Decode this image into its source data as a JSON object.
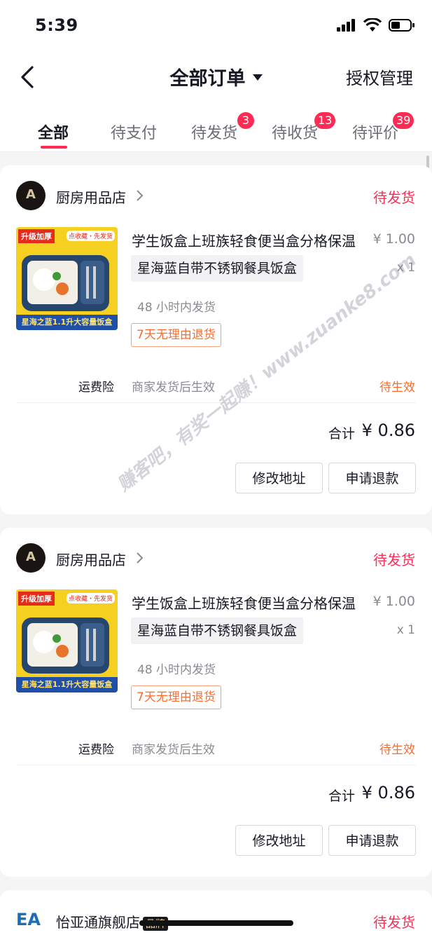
{
  "status_bar": {
    "time": "5:39"
  },
  "nav": {
    "title": "全部订单",
    "right": "授权管理"
  },
  "tabs": [
    {
      "label": "全部"
    },
    {
      "label": "待支付"
    },
    {
      "label": "待发货",
      "badge": "3"
    },
    {
      "label": "待收货",
      "badge": "13"
    },
    {
      "label": "待评价",
      "badge": "39"
    }
  ],
  "orders": [
    {
      "shop": "厨房用品店",
      "shop_logo_text": "A",
      "status": "待发货",
      "image_tags": {
        "top": "升级加厚",
        "fav": "点收藏・先发货",
        "bottom": "星海之蓝1.1升大容量饭盒"
      },
      "title": "学生饭盒上班族轻食便当盒分格保温",
      "price": "¥ 1.00",
      "sku": "星海蓝自带不锈钢餐具饭盒",
      "qty": "x 1",
      "ship_note": "48 小时内发货",
      "return_tag": "7天无理由退货",
      "insurance": {
        "label": "运费险",
        "desc": "商家发货后生效",
        "status": "待生效"
      },
      "total_label": "合计",
      "total": "¥ 0.86",
      "buttons": {
        "address": "修改地址",
        "refund": "申请退款"
      }
    },
    {
      "shop": "厨房用品店",
      "shop_logo_text": "A",
      "status": "待发货",
      "image_tags": {
        "top": "升级加厚",
        "fav": "点收藏・先发货",
        "bottom": "星海之蓝1.1升大容量饭盒"
      },
      "title": "学生饭盒上班族轻食便当盒分格保温",
      "price": "¥ 1.00",
      "sku": "星海蓝自带不锈钢餐具饭盒",
      "qty": "x 1",
      "ship_note": "48 小时内发货",
      "return_tag": "7天无理由退货",
      "insurance": {
        "label": "运费险",
        "desc": "商家发货后生效",
        "status": "待生效"
      },
      "total_label": "合计",
      "total": "¥ 0.86",
      "buttons": {
        "address": "修改地址",
        "refund": "申请退款"
      }
    },
    {
      "shop": "怡亚通旗舰店",
      "shop_logo_text": "EA",
      "brand_tag": "品牌",
      "status": "待发货"
    }
  ],
  "watermark": "赚客吧，有奖一起赚！www.zuanke8.com"
}
